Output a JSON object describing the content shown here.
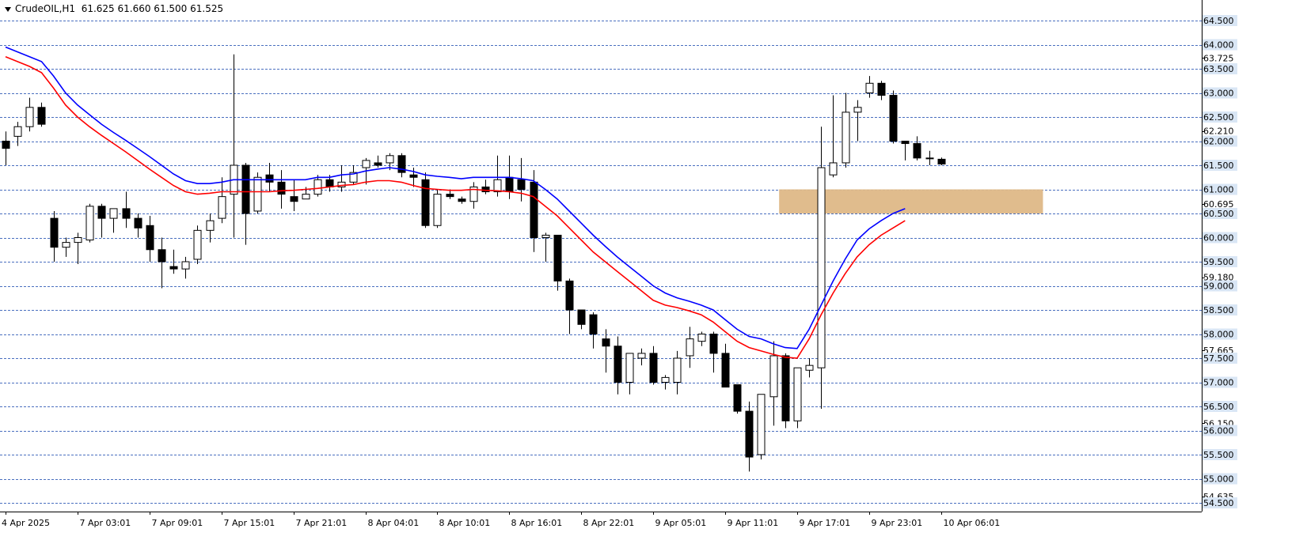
{
  "header": {
    "symbol": "CrudeOIL,H1",
    "ohlc": "61.625 61.660 61.500 61.525"
  },
  "colors": {
    "background": "#ffffff",
    "grid": "#4a6fbf",
    "bull_fill": "#ffffff",
    "bear_fill": "#000000",
    "ma_fast": "#0000ff",
    "ma_slow": "#ff0000",
    "zone": "#deb887",
    "label_box": "#d9e6f5"
  },
  "chart_data": {
    "type": "candlestick",
    "ylim": [
      54.3,
      64.7
    ],
    "grid_levels": [
      64.5,
      64.0,
      63.5,
      63.0,
      62.5,
      62.0,
      61.5,
      61.0,
      60.5,
      60.0,
      59.5,
      59.0,
      58.5,
      58.0,
      57.5,
      57.0,
      56.5,
      56.0,
      55.5,
      55.0,
      54.5
    ],
    "y_ticks": [
      {
        "value": 64.5,
        "label": "64.500",
        "boxed": true
      },
      {
        "value": 64.0,
        "label": "64.000",
        "boxed": true
      },
      {
        "value": 63.725,
        "label": "63.725",
        "boxed": false
      },
      {
        "value": 63.5,
        "label": "63.500",
        "boxed": true
      },
      {
        "value": 63.0,
        "label": "63.000",
        "boxed": true
      },
      {
        "value": 62.5,
        "label": "62.500",
        "boxed": true
      },
      {
        "value": 62.21,
        "label": "62.210",
        "boxed": false
      },
      {
        "value": 62.0,
        "label": "62.000",
        "boxed": true
      },
      {
        "value": 61.5,
        "label": "61.500",
        "boxed": true
      },
      {
        "value": 61.0,
        "label": "61.000",
        "boxed": true
      },
      {
        "value": 60.695,
        "label": "60.695",
        "boxed": false
      },
      {
        "value": 60.5,
        "label": "60.500",
        "boxed": true
      },
      {
        "value": 60.0,
        "label": "60.000",
        "boxed": true
      },
      {
        "value": 59.5,
        "label": "59.500",
        "boxed": true
      },
      {
        "value": 59.18,
        "label": "59.180",
        "boxed": false
      },
      {
        "value": 59.0,
        "label": "59.000",
        "boxed": true
      },
      {
        "value": 58.5,
        "label": "58.500",
        "boxed": true
      },
      {
        "value": 58.0,
        "label": "58.000",
        "boxed": true
      },
      {
        "value": 57.665,
        "label": "57.665",
        "boxed": false
      },
      {
        "value": 57.5,
        "label": "57.500",
        "boxed": true
      },
      {
        "value": 57.0,
        "label": "57.000",
        "boxed": true
      },
      {
        "value": 56.5,
        "label": "56.500",
        "boxed": true
      },
      {
        "value": 56.15,
        "label": "56.150",
        "boxed": false
      },
      {
        "value": 56.0,
        "label": "56.000",
        "boxed": true
      },
      {
        "value": 55.5,
        "label": "55.500",
        "boxed": true
      },
      {
        "value": 55.0,
        "label": "55.000",
        "boxed": true
      },
      {
        "value": 54.635,
        "label": "54.635",
        "boxed": false
      },
      {
        "value": 54.5,
        "label": "54.500",
        "boxed": true
      }
    ],
    "x_ticks": [
      {
        "index": 0,
        "label": "4 Apr 2025"
      },
      {
        "index": 6,
        "label": "7 Apr 03:01"
      },
      {
        "index": 12,
        "label": "7 Apr 09:01"
      },
      {
        "index": 18,
        "label": "7 Apr 15:01"
      },
      {
        "index": 24,
        "label": "7 Apr 21:01"
      },
      {
        "index": 30,
        "label": "8 Apr 04:01"
      },
      {
        "index": 36,
        "label": "8 Apr 10:01"
      },
      {
        "index": 42,
        "label": "8 Apr 16:01"
      },
      {
        "index": 48,
        "label": "8 Apr 22:01"
      },
      {
        "index": 54,
        "label": "9 Apr 05:01"
      },
      {
        "index": 60,
        "label": "9 Apr 11:01"
      },
      {
        "index": 66,
        "label": "9 Apr 17:01"
      },
      {
        "index": 72,
        "label": "9 Apr 23:01"
      },
      {
        "index": 78,
        "label": "10 Apr 06:01"
      }
    ],
    "candles": [
      [
        62.0,
        62.2,
        61.5,
        61.85
      ],
      [
        62.1,
        62.4,
        61.9,
        62.3
      ],
      [
        62.3,
        62.9,
        62.2,
        62.7
      ],
      [
        62.7,
        62.8,
        62.3,
        62.35
      ],
      [
        60.4,
        60.55,
        59.5,
        59.8
      ],
      [
        59.8,
        60.0,
        59.6,
        59.9
      ],
      [
        59.9,
        60.1,
        59.45,
        60.0
      ],
      [
        59.95,
        60.7,
        59.9,
        60.65
      ],
      [
        60.65,
        60.7,
        60.0,
        60.4
      ],
      [
        60.4,
        60.6,
        60.1,
        60.6
      ],
      [
        60.6,
        60.95,
        60.2,
        60.4
      ],
      [
        60.4,
        60.5,
        60.0,
        60.2
      ],
      [
        60.25,
        60.45,
        59.5,
        59.75
      ],
      [
        59.75,
        60.0,
        58.95,
        59.5
      ],
      [
        59.4,
        59.75,
        59.25,
        59.35
      ],
      [
        59.35,
        59.6,
        59.15,
        59.5
      ],
      [
        59.55,
        60.25,
        59.45,
        60.15
      ],
      [
        60.15,
        60.5,
        59.9,
        60.35
      ],
      [
        60.4,
        61.25,
        60.3,
        60.85
      ],
      [
        60.9,
        63.8,
        60.0,
        61.5
      ],
      [
        61.5,
        61.55,
        59.85,
        60.5
      ],
      [
        60.55,
        61.35,
        60.5,
        61.25
      ],
      [
        61.3,
        61.55,
        60.95,
        61.15
      ],
      [
        61.15,
        61.4,
        60.6,
        60.9
      ],
      [
        60.85,
        61.2,
        60.55,
        60.75
      ],
      [
        60.8,
        61.05,
        60.8,
        60.9
      ],
      [
        60.9,
        61.3,
        60.85,
        61.2
      ],
      [
        61.2,
        61.3,
        60.95,
        61.05
      ],
      [
        61.05,
        61.5,
        60.95,
        61.15
      ],
      [
        61.15,
        61.5,
        61.1,
        61.35
      ],
      [
        61.45,
        61.65,
        61.1,
        61.6
      ],
      [
        61.55,
        61.7,
        61.45,
        61.5
      ],
      [
        61.55,
        61.75,
        61.4,
        61.7
      ],
      [
        61.7,
        61.75,
        61.25,
        61.35
      ],
      [
        61.3,
        61.45,
        61.05,
        61.25
      ],
      [
        61.2,
        61.35,
        60.2,
        60.25
      ],
      [
        60.25,
        61.0,
        60.2,
        60.9
      ],
      [
        60.9,
        61.0,
        60.8,
        60.85
      ],
      [
        60.8,
        60.85,
        60.7,
        60.75
      ],
      [
        60.75,
        61.15,
        60.6,
        61.05
      ],
      [
        61.05,
        61.2,
        60.9,
        60.95
      ],
      [
        60.95,
        61.7,
        60.85,
        61.2
      ],
      [
        61.25,
        61.7,
        60.8,
        60.95
      ],
      [
        61.2,
        61.65,
        60.75,
        61.0
      ],
      [
        61.15,
        61.4,
        59.7,
        60.0
      ],
      [
        60.0,
        60.1,
        59.5,
        60.05
      ],
      [
        60.05,
        60.05,
        58.9,
        59.1
      ],
      [
        59.1,
        59.15,
        58.0,
        58.5
      ],
      [
        58.5,
        58.5,
        58.1,
        58.2
      ],
      [
        58.4,
        58.45,
        57.7,
        58.0
      ],
      [
        57.9,
        58.1,
        57.2,
        57.75
      ],
      [
        57.75,
        57.95,
        56.75,
        57.0
      ],
      [
        57.0,
        57.6,
        56.75,
        57.6
      ],
      [
        57.5,
        57.7,
        57.35,
        57.6
      ],
      [
        57.6,
        57.75,
        56.95,
        57.0
      ],
      [
        57.0,
        57.15,
        56.85,
        57.1
      ],
      [
        57.0,
        57.65,
        56.75,
        57.5
      ],
      [
        57.55,
        58.15,
        57.3,
        57.9
      ],
      [
        57.85,
        58.05,
        57.75,
        58.0
      ],
      [
        58.0,
        58.05,
        57.2,
        57.6
      ],
      [
        57.6,
        57.8,
        56.9,
        56.9
      ],
      [
        56.95,
        56.95,
        56.35,
        56.4
      ],
      [
        56.4,
        56.6,
        55.15,
        55.45
      ],
      [
        55.5,
        56.75,
        55.4,
        56.75
      ],
      [
        56.7,
        57.85,
        56.1,
        57.55
      ],
      [
        57.55,
        57.6,
        56.05,
        56.2
      ],
      [
        56.2,
        57.3,
        56.05,
        57.3
      ],
      [
        57.25,
        57.5,
        57.1,
        57.35
      ],
      [
        57.3,
        62.3,
        56.45,
        61.45
      ],
      [
        61.3,
        62.95,
        61.25,
        61.55
      ],
      [
        61.55,
        63.0,
        61.45,
        62.6
      ],
      [
        62.6,
        62.85,
        62.0,
        62.7
      ],
      [
        63.0,
        63.35,
        62.9,
        63.2
      ],
      [
        63.2,
        63.25,
        62.85,
        62.95
      ],
      [
        62.95,
        63.05,
        61.95,
        62.0
      ],
      [
        62.0,
        62.0,
        61.6,
        61.95
      ],
      [
        61.95,
        62.1,
        61.6,
        61.65
      ],
      [
        61.65,
        61.8,
        61.5,
        61.65
      ],
      [
        61.625,
        61.66,
        61.5,
        61.525
      ]
    ],
    "ma_fast": [
      [
        0,
        63.95
      ],
      [
        1,
        63.85
      ],
      [
        2,
        63.75
      ],
      [
        3,
        63.65
      ],
      [
        4,
        63.35
      ],
      [
        5,
        63.0
      ],
      [
        6,
        62.75
      ],
      [
        7,
        62.55
      ],
      [
        8,
        62.35
      ],
      [
        9,
        62.18
      ],
      [
        10,
        62.02
      ],
      [
        11,
        61.85
      ],
      [
        12,
        61.68
      ],
      [
        13,
        61.5
      ],
      [
        14,
        61.32
      ],
      [
        15,
        61.18
      ],
      [
        16,
        61.12
      ],
      [
        17,
        61.12
      ],
      [
        18,
        61.15
      ],
      [
        19,
        61.2
      ],
      [
        20,
        61.2
      ],
      [
        21,
        61.2
      ],
      [
        22,
        61.2
      ],
      [
        23,
        61.2
      ],
      [
        24,
        61.2
      ],
      [
        25,
        61.2
      ],
      [
        26,
        61.25
      ],
      [
        27,
        61.25
      ],
      [
        28,
        61.3
      ],
      [
        29,
        61.32
      ],
      [
        30,
        61.38
      ],
      [
        31,
        61.42
      ],
      [
        32,
        61.45
      ],
      [
        33,
        61.42
      ],
      [
        34,
        61.37
      ],
      [
        35,
        61.3
      ],
      [
        36,
        61.27
      ],
      [
        37,
        61.25
      ],
      [
        38,
        61.22
      ],
      [
        39,
        61.25
      ],
      [
        40,
        61.25
      ],
      [
        41,
        61.25
      ],
      [
        42,
        61.25
      ],
      [
        43,
        61.22
      ],
      [
        44,
        61.18
      ],
      [
        45,
        61.0
      ],
      [
        46,
        60.8
      ],
      [
        47,
        60.55
      ],
      [
        48,
        60.3
      ],
      [
        49,
        60.05
      ],
      [
        50,
        59.82
      ],
      [
        51,
        59.6
      ],
      [
        52,
        59.4
      ],
      [
        53,
        59.2
      ],
      [
        54,
        59.0
      ],
      [
        55,
        58.85
      ],
      [
        56,
        58.75
      ],
      [
        57,
        58.68
      ],
      [
        58,
        58.6
      ],
      [
        59,
        58.5
      ],
      [
        60,
        58.3
      ],
      [
        61,
        58.1
      ],
      [
        62,
        57.95
      ],
      [
        63,
        57.9
      ],
      [
        64,
        57.8
      ],
      [
        65,
        57.72
      ],
      [
        66,
        57.7
      ],
      [
        67,
        58.1
      ],
      [
        68,
        58.6
      ],
      [
        69,
        59.1
      ],
      [
        70,
        59.55
      ],
      [
        71,
        59.95
      ],
      [
        72,
        60.18
      ],
      [
        73,
        60.35
      ],
      [
        74,
        60.5
      ],
      [
        75,
        60.6
      ]
    ],
    "ma_slow": [
      [
        0,
        63.75
      ],
      [
        1,
        63.65
      ],
      [
        2,
        63.55
      ],
      [
        3,
        63.42
      ],
      [
        4,
        63.1
      ],
      [
        5,
        62.75
      ],
      [
        6,
        62.5
      ],
      [
        7,
        62.3
      ],
      [
        8,
        62.12
      ],
      [
        9,
        61.95
      ],
      [
        10,
        61.78
      ],
      [
        11,
        61.6
      ],
      [
        12,
        61.42
      ],
      [
        13,
        61.25
      ],
      [
        14,
        61.08
      ],
      [
        15,
        60.95
      ],
      [
        16,
        60.9
      ],
      [
        17,
        60.92
      ],
      [
        18,
        60.95
      ],
      [
        19,
        60.95
      ],
      [
        20,
        60.95
      ],
      [
        21,
        60.95
      ],
      [
        22,
        60.95
      ],
      [
        23,
        60.97
      ],
      [
        24,
        60.98
      ],
      [
        25,
        61.0
      ],
      [
        26,
        61.02
      ],
      [
        27,
        61.05
      ],
      [
        28,
        61.08
      ],
      [
        29,
        61.1
      ],
      [
        30,
        61.15
      ],
      [
        31,
        61.18
      ],
      [
        32,
        61.18
      ],
      [
        33,
        61.15
      ],
      [
        34,
        61.08
      ],
      [
        35,
        61.02
      ],
      [
        36,
        61.0
      ],
      [
        37,
        60.98
      ],
      [
        38,
        60.98
      ],
      [
        39,
        61.0
      ],
      [
        40,
        60.98
      ],
      [
        41,
        60.97
      ],
      [
        42,
        60.95
      ],
      [
        43,
        60.92
      ],
      [
        44,
        60.85
      ],
      [
        45,
        60.65
      ],
      [
        46,
        60.45
      ],
      [
        47,
        60.2
      ],
      [
        48,
        59.95
      ],
      [
        49,
        59.7
      ],
      [
        50,
        59.5
      ],
      [
        51,
        59.3
      ],
      [
        52,
        59.1
      ],
      [
        53,
        58.9
      ],
      [
        54,
        58.7
      ],
      [
        55,
        58.6
      ],
      [
        56,
        58.55
      ],
      [
        57,
        58.48
      ],
      [
        58,
        58.4
      ],
      [
        59,
        58.25
      ],
      [
        60,
        58.05
      ],
      [
        61,
        57.85
      ],
      [
        62,
        57.72
      ],
      [
        63,
        57.65
      ],
      [
        64,
        57.58
      ],
      [
        65,
        57.52
      ],
      [
        66,
        57.5
      ],
      [
        67,
        57.9
      ],
      [
        68,
        58.4
      ],
      [
        69,
        58.85
      ],
      [
        70,
        59.25
      ],
      [
        71,
        59.6
      ],
      [
        72,
        59.85
      ],
      [
        73,
        60.05
      ],
      [
        74,
        60.2
      ],
      [
        75,
        60.35
      ]
    ],
    "zone": {
      "y_low": 60.5,
      "y_high": 61.0,
      "x_start": 64.5,
      "x_end": 86.5
    }
  }
}
